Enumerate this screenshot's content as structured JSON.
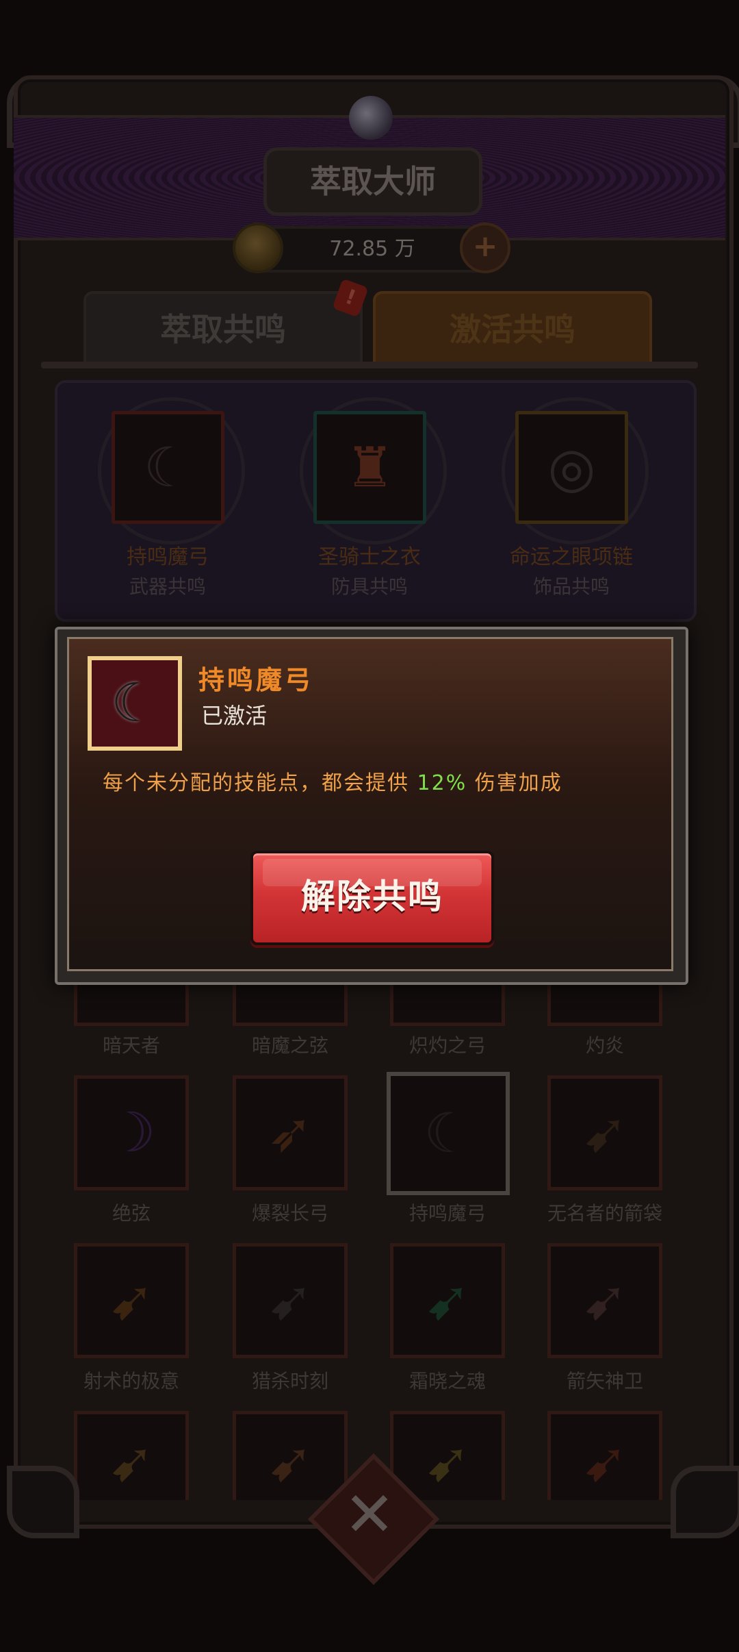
{
  "header": {
    "title": "萃取大师",
    "currency_amount": "72.85 万"
  },
  "tabs": {
    "extract": "萃取共鸣",
    "activate": "激活共鸣",
    "notice_badge": "!"
  },
  "resonance_slots": [
    {
      "name": "持鸣魔弓",
      "type": "武器共鸣",
      "glyph": "弓",
      "border_color": "#3a1512"
    },
    {
      "name": "圣骑士之衣",
      "type": "防具共鸣",
      "glyph": "衣",
      "border_color": "#13302a"
    },
    {
      "name": "命运之眼项链",
      "type": "饰品共鸣",
      "glyph": "链",
      "border_color": "#3a2a10"
    }
  ],
  "bow_grid": {
    "row1": [
      "暗天者",
      "暗魔之弦",
      "炽灼之弓",
      "灼炎"
    ],
    "row2": [
      "绝弦",
      "爆裂长弓",
      "持鸣魔弓",
      "无名者的箭袋"
    ],
    "row3": [
      "射术的极意",
      "猎杀时刻",
      "霜晓之魂",
      "箭矢神卫"
    ]
  },
  "dialog": {
    "item_name": "持鸣魔弓",
    "status": "已激活",
    "desc_before": "每个未分配的技能点，都会提供 ",
    "desc_pct": "12%",
    "desc_after": " 伤害加成",
    "release_button": "解除共鸣"
  },
  "colors": {
    "title_orange": "#f08a28",
    "desc_orange": "#f0a24a",
    "percent_green": "#7fe04a",
    "button_red": "#d33436",
    "frame_gold": "#f0cf8c"
  },
  "icons": {
    "coin": "coin-icon",
    "plus": "plus-icon",
    "close": "close-emblem-icon"
  }
}
